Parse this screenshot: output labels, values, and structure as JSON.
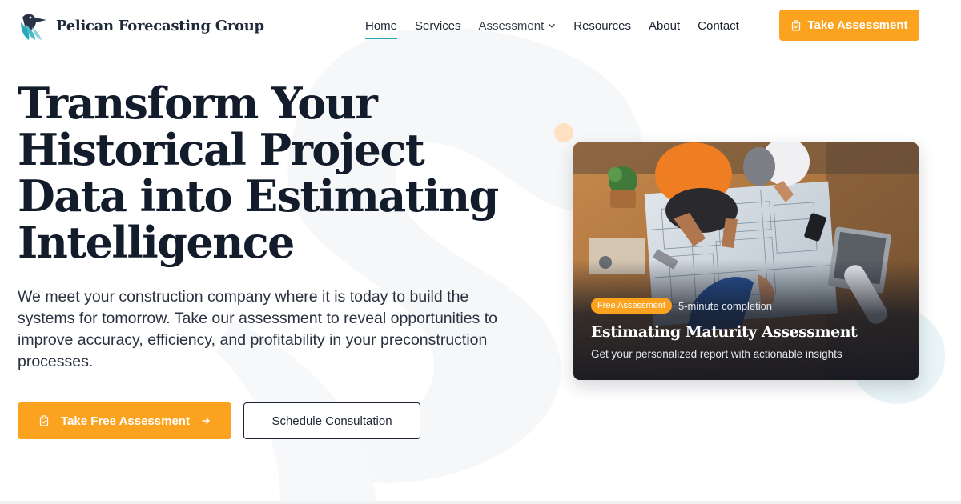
{
  "brand": {
    "name": "Pelican Forecasting Group",
    "logo_icon": "pelican-logo-icon"
  },
  "nav": {
    "items": [
      {
        "label": "Home",
        "active": true
      },
      {
        "label": "Services"
      },
      {
        "label": "Assessment",
        "dropdown": true
      },
      {
        "label": "Resources"
      },
      {
        "label": "About"
      },
      {
        "label": "Contact"
      }
    ],
    "cta": "Take Assessment",
    "cta_icon": "clipboard-icon"
  },
  "hero": {
    "title": "Transform Your Historical Project Data into Estimating Intelligence",
    "description": "We meet your construction company where it is today to build the systems for tomorrow. Take our assessment to reveal opportunities to improve accuracy, efficiency, and profitability in your preconstruction processes.",
    "primary_button": "Take Free Assessment",
    "primary_icon": "clipboard-icon",
    "primary_arrow": "arrow-right-icon",
    "secondary_button": "Schedule Consultation"
  },
  "card": {
    "image": "construction-team-blueprint-photo",
    "badge": "Free Assessment",
    "duration": "5-minute completion",
    "title": "Estimating Maturity Assessment",
    "subtitle": "Get your personalized report with actionable insights"
  },
  "colors": {
    "accent": "#fba21e",
    "teal": "#27a7b8",
    "heading": "#131c2b",
    "text": "#2a3240"
  }
}
